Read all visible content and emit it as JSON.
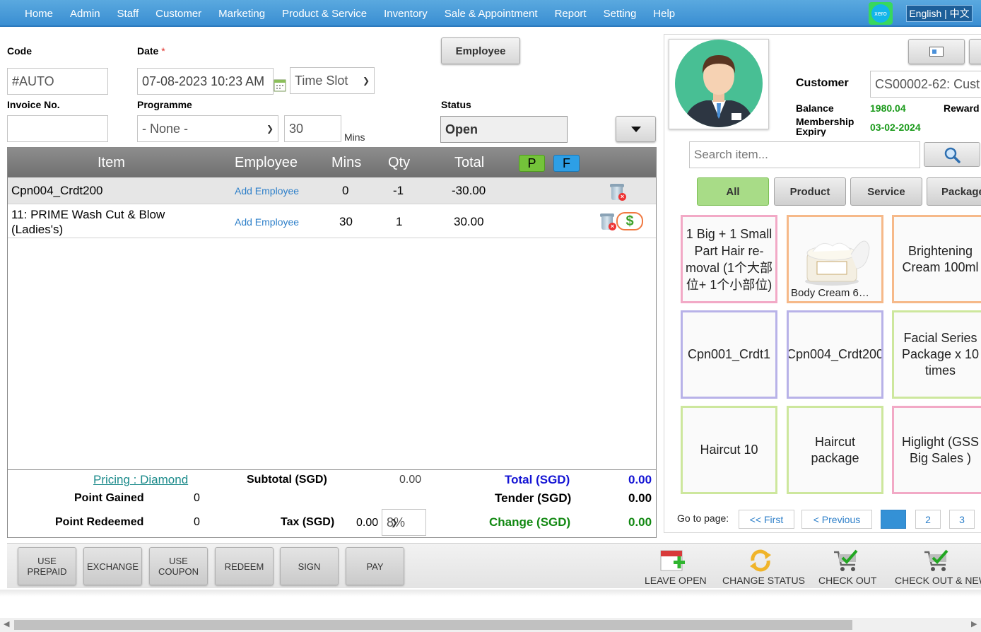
{
  "nav": {
    "items": [
      "Home",
      "Admin",
      "Staff",
      "Customer",
      "Marketing",
      "Product & Service",
      "Inventory",
      "Sale & Appointment",
      "Report",
      "Setting",
      "Help"
    ],
    "xero_label": "xero",
    "language": "English | 中文"
  },
  "form": {
    "code_label": "Code",
    "code_value": "#AUTO",
    "date_label": "Date",
    "date_required": "*",
    "date_value": "07-08-2023 10:23 AM",
    "timeslot_value": "Time Slot",
    "employee_button": "Employee",
    "invoice_label": "Invoice No.",
    "invoice_value": "",
    "programme_label": "Programme",
    "programme_value": "- None -",
    "mins_value": "30",
    "mins_label": "Mins",
    "status_label": "Status",
    "status_value": "Open"
  },
  "table": {
    "headers": {
      "item": "Item",
      "employee": "Employee",
      "mins": "Mins",
      "qty": "Qty",
      "total": "Total",
      "p": "P",
      "f": "F"
    },
    "rows": [
      {
        "item": "Cpn004_Crdt200",
        "employee": "Add Employee",
        "mins": "0",
        "qty": "-1",
        "total": "-30.00"
      },
      {
        "item": "11: PRIME Wash Cut & Blow (Ladies's)",
        "employee": "Add Employee",
        "mins": "30",
        "qty": "1",
        "total": "30.00"
      }
    ],
    "dollar_symbol": "$"
  },
  "summary": {
    "pricing": "Pricing : Diamond",
    "subtotal_label": "Subtotal (SGD)",
    "subtotal_value": "0.00",
    "total_label": "Total (SGD)",
    "total_value": "0.00",
    "point_gained_label": "Point Gained",
    "point_gained_value": "0",
    "tender_label": "Tender (SGD)",
    "tender_value": "0.00",
    "point_redeemed_label": "Point Redeemed",
    "point_redeemed_value": "0",
    "tax_label": "Tax (SGD)",
    "tax_value": "0.00",
    "tax_rate": "8%",
    "change_label": "Change (SGD)",
    "change_value": "0.00"
  },
  "actions": {
    "use_prepaid": "USE PREPAID",
    "exchange": "EXCHANGE",
    "use_coupon": "USE COUPON",
    "redeem": "REDEEM",
    "sign": "SIGN",
    "pay": "PAY",
    "leave_open": "LEAVE OPEN",
    "change_status": "CHANGE STATUS",
    "check_out": "CHECK OUT",
    "check_out_new": "CHECK OUT & NEW"
  },
  "customer": {
    "label": "Customer",
    "value": "CS00002-62: Cust",
    "balance_label": "Balance",
    "balance_value": "1980.04",
    "reward_label": "Reward",
    "membership_label": "Membership Expiry",
    "membership_value": "03-02-2024"
  },
  "search": {
    "placeholder": "Search item..."
  },
  "categories": [
    "All",
    "Product",
    "Service",
    "Package"
  ],
  "tiles": [
    "1 Big + 1 Small Part Hair re-moval (1个大部位+ 1个小部位)",
    "Body Cream 6…",
    "Brightening Cream 100ml",
    "Cpn001_Crdt1",
    "Cpn004_Crdt200",
    "Facial Series Package x 10 times",
    "Haircut 10",
    "Haircut package",
    "Higlight (GSS Big Sales )"
  ],
  "pagination": {
    "label": "Go to page:",
    "first": "<< First",
    "previous": "< Previous",
    "pages": [
      "1",
      "2",
      "3"
    ]
  },
  "colors": {
    "nav": "#3a8ed2",
    "green_value": "#1a9a1a",
    "total_blue": "#1414d4",
    "change_green": "#118811",
    "link_blue": "#2d7fc9"
  }
}
